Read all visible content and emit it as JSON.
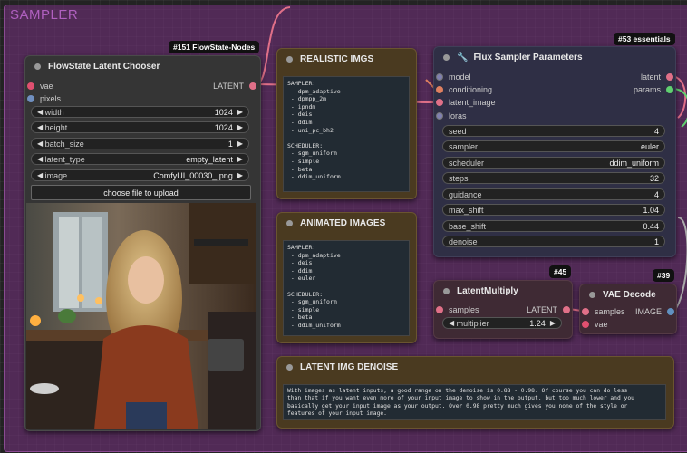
{
  "group": {
    "title": "SAMPLER"
  },
  "latent_chooser": {
    "badge": "#151 FlowState-Nodes",
    "title": "FlowState Latent Chooser",
    "inputs": [
      "vae",
      "pixels"
    ],
    "output": "LATENT",
    "widgets": [
      {
        "label": "width",
        "value": "1024"
      },
      {
        "label": "height",
        "value": "1024"
      },
      {
        "label": "batch_size",
        "value": "1"
      },
      {
        "label": "latent_type",
        "value": "empty_latent"
      },
      {
        "label": "image",
        "value": "ComfyUI_00030_.png"
      }
    ],
    "upload_label": "choose file to upload"
  },
  "realistic": {
    "title": "REALISTIC IMGS",
    "text": "SAMPLER:\n - dpm_adaptive\n - dpmpp_2m\n - ipndm\n - deis\n - ddim\n - uni_pc_bh2\n\nSCHEDULER:\n - sgm_uniform\n - simple\n - beta\n - ddim_uniform"
  },
  "animated": {
    "title": "ANIMATED IMAGES",
    "text": "SAMPLER:\n - dpm_adaptive\n - deis\n - ddim\n - euler\n\nSCHEDULER:\n - sgm_uniform\n - simple\n - beta\n - ddim_uniform"
  },
  "flux": {
    "badge": "#53 essentials",
    "title": "Flux Sampler Parameters",
    "inputs": [
      "model",
      "conditioning",
      "latent_image",
      "loras"
    ],
    "outputs": [
      "latent",
      "params"
    ],
    "widgets": [
      {
        "label": "seed",
        "value": "4"
      },
      {
        "label": "sampler",
        "value": "euler"
      },
      {
        "label": "scheduler",
        "value": "ddim_uniform"
      },
      {
        "label": "steps",
        "value": "32"
      },
      {
        "label": "guidance",
        "value": "4"
      },
      {
        "label": "max_shift",
        "value": "1.04"
      },
      {
        "label": "base_shift",
        "value": "0.44"
      },
      {
        "label": "denoise",
        "value": "1"
      }
    ]
  },
  "latent_multiply": {
    "badge": "#45",
    "title": "LatentMultiply",
    "input": "samples",
    "output": "LATENT",
    "widget": {
      "label": "multiplier",
      "value": "1.24"
    }
  },
  "vae_decode": {
    "badge": "#39",
    "title": "VAE Decode",
    "inputs": [
      "samples",
      "vae"
    ],
    "output": "IMAGE"
  },
  "denoise_note": {
    "title": "LATENT IMG DENOISE",
    "text": "With images as latent inputs, a good range on the denoise is 0.88 - 0.98. Of course you can do less\nthan that if you want even more of your input image to show in the output, but too much lower and you\nbasically get your input image as your output. Over 0.98 pretty much gives you none of the style or\nfeatures of your input image."
  },
  "colors": {
    "group": "#7a3282",
    "note": "#4a3a20",
    "flux_node": "#2f2f45"
  }
}
